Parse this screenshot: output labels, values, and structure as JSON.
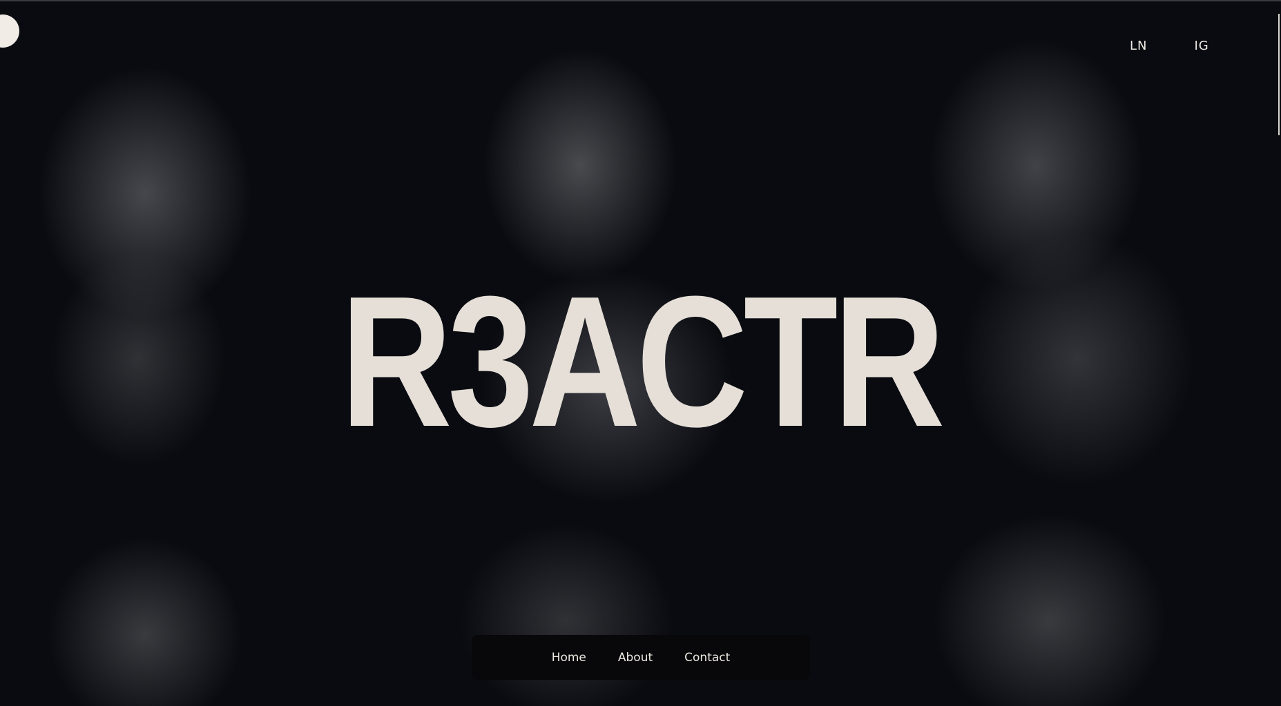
{
  "brand": {
    "logo": "circle-logo",
    "hero_title": "R3ACTR"
  },
  "header": {
    "social_links": [
      {
        "label": "LN",
        "icon": "linkedin-link"
      },
      {
        "label": "IG",
        "icon": "instagram-link"
      }
    ]
  },
  "nav": {
    "items": [
      {
        "label": "Home"
      },
      {
        "label": "About"
      },
      {
        "label": "Contact"
      }
    ]
  },
  "colors": {
    "background": "#0a0b10",
    "text": "#e5dfd8",
    "nav_background": "#08080a"
  }
}
